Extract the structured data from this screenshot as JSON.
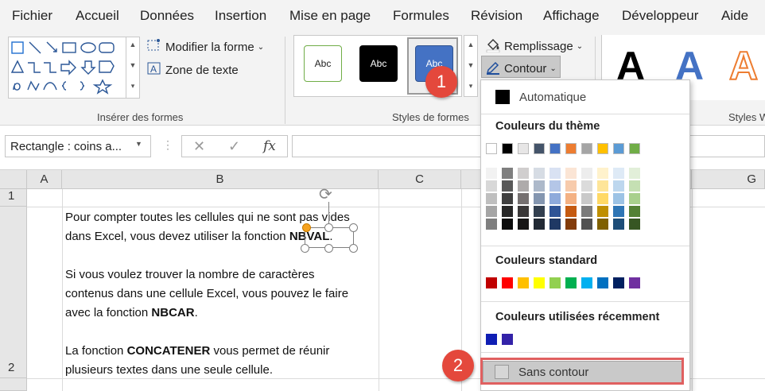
{
  "menu": {
    "items": [
      "Fichier",
      "Accueil",
      "Données",
      "Insertion",
      "Mise en page",
      "Formules",
      "Révision",
      "Affichage",
      "Développeur",
      "Aide"
    ]
  },
  "ribbon": {
    "insert_shapes": {
      "label": "Insérer des formes",
      "modify_shape": "Modifier la forme",
      "text_box": "Zone de texte"
    },
    "shape_styles": {
      "label": "Styles de formes",
      "swatches": [
        "Abc",
        "Abc",
        "Abc"
      ],
      "fill": "Remplissage",
      "outline": "Contour"
    },
    "wordart": {
      "label": "Styles W",
      "letters": [
        "A",
        "A",
        "A"
      ]
    }
  },
  "formula_bar": {
    "name_box": "Rectangle : coins a...",
    "cancel": "✕",
    "enter": "✓",
    "fx": "fx",
    "value": ""
  },
  "grid": {
    "columns": [
      "A",
      "B",
      "C",
      "G"
    ],
    "rows": [
      "1",
      "2"
    ],
    "cell_text": {
      "line1": "Pour compter toutes les cellules qui ne sont pas vides",
      "line2_pre": "dans Excel, vous devez utiliser la fonction ",
      "line2_bold": "NBVAL",
      "line2_post": ".",
      "line3": "Si vous voulez trouver la nombre de caractères",
      "line4": "contenus dans une cellule Excel, vous pouvez le faire",
      "line5_pre": "avec la fonction ",
      "line5_bold": "NBCAR",
      "line5_post": ".",
      "line6_pre": "La fonction ",
      "line6_bold": "CONCATENER",
      "line6_post": " vous permet de réunir",
      "line7": "plusieurs textes dans une seule cellule."
    }
  },
  "dropdown": {
    "automatic": "Automatique",
    "theme_colors_title": "Couleurs du thème",
    "standard_colors_title": "Couleurs standard",
    "recent_colors_title": "Couleurs utilisées récemment",
    "no_outline": "Sans contour",
    "theme_top": [
      "#ffffff",
      "#000000",
      "#e7e6e6",
      "#44546a",
      "#4472c4",
      "#ed7d31",
      "#a5a5a5",
      "#ffc000",
      "#5b9bd5",
      "#70ad47"
    ],
    "theme_shades": [
      [
        "#f2f2f2",
        "#7f7f7f",
        "#d0cece",
        "#d6dce4",
        "#d9e2f3",
        "#fbe5d5",
        "#ededed",
        "#fff2cc",
        "#deeaf6",
        "#e2efd9"
      ],
      [
        "#d8d8d8",
        "#595959",
        "#aeabab",
        "#adb9ca",
        "#b4c6e7",
        "#f7cbac",
        "#dbdbdb",
        "#fee599",
        "#bdd7ee",
        "#c5e0b3"
      ],
      [
        "#bfbfbf",
        "#3f3f3f",
        "#757070",
        "#8496b0",
        "#8eaadb",
        "#f4b183",
        "#c9c9c9",
        "#ffd965",
        "#9cc3e5",
        "#a8d08d"
      ],
      [
        "#a5a5a5",
        "#262626",
        "#3a3838",
        "#323f4f",
        "#2f5496",
        "#c55a11",
        "#7b7b7b",
        "#bf8f00",
        "#2e75b5",
        "#538135"
      ],
      [
        "#7f7f7f",
        "#0c0c0c",
        "#171616",
        "#222a35",
        "#1f3864",
        "#833c0b",
        "#525252",
        "#7f6000",
        "#1e4e79",
        "#375623"
      ]
    ],
    "standard": [
      "#c00000",
      "#ff0000",
      "#ffc000",
      "#ffff00",
      "#92d050",
      "#00b050",
      "#00b0f0",
      "#0070c0",
      "#002060",
      "#7030a0"
    ],
    "recent": [
      "#0f1eb4",
      "#3322a8"
    ]
  },
  "badges": [
    "1",
    "2"
  ],
  "colors": {
    "badge": "#e4483c",
    "highlight": "#e06060",
    "wordart_blue": "#4472c4",
    "wordart_orange": "#ed7d31"
  }
}
